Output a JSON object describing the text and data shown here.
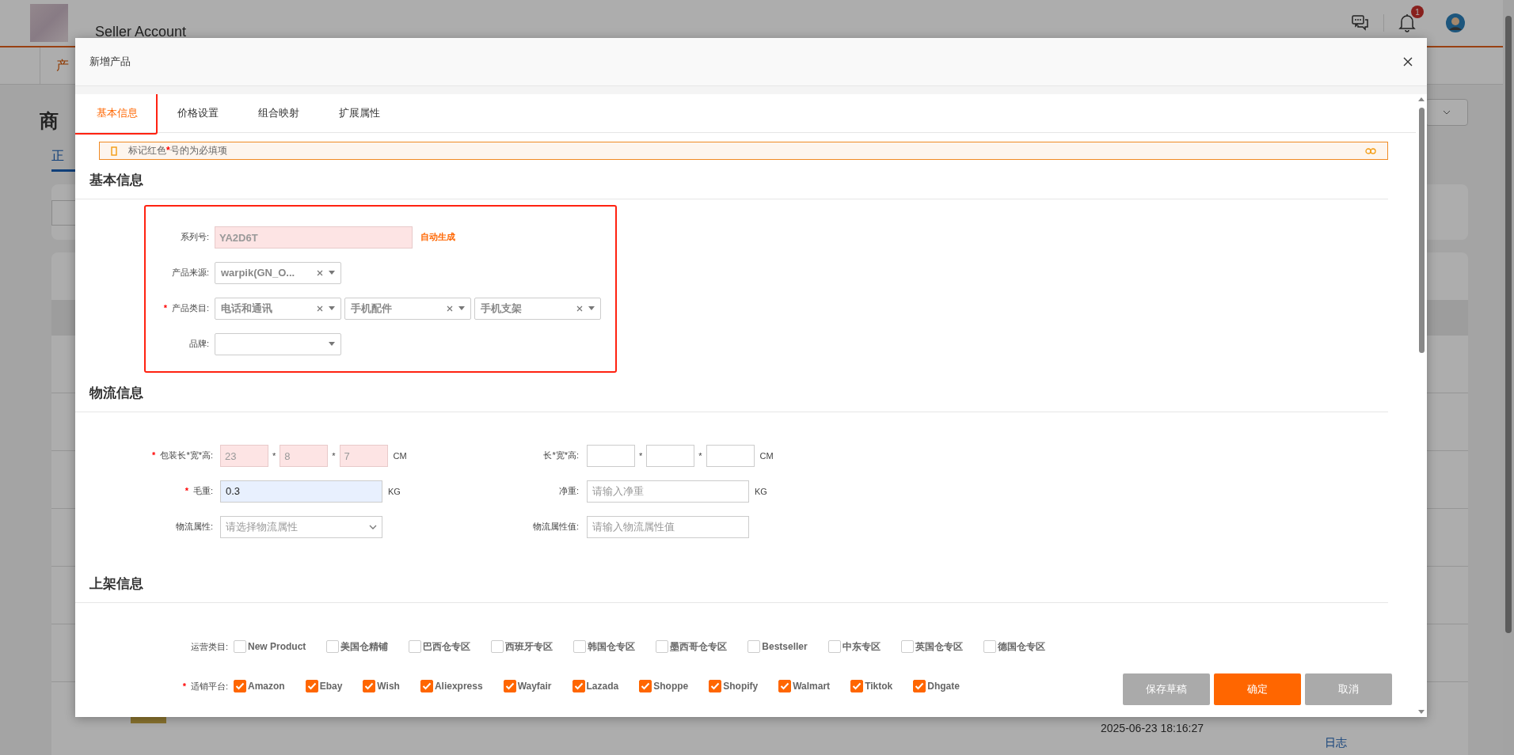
{
  "app_header": {
    "title": "Seller Account",
    "notification_count": "1"
  },
  "background": {
    "nav_tab": "产",
    "page_title": "商",
    "status_tab": "正",
    "row_time": "2025-06-23 18:16:27",
    "row_link": "日志"
  },
  "modal": {
    "title": "新增产品",
    "tabs": [
      {
        "label": "基本信息",
        "selected": true
      },
      {
        "label": "价格设置",
        "selected": false
      },
      {
        "label": "组合映射",
        "selected": false
      },
      {
        "label": "扩展属性",
        "selected": false
      }
    ],
    "notice": {
      "before": "标记红色",
      "mark": "*",
      "after": "号的为必填项"
    },
    "basic": {
      "title": "基本信息",
      "highlighted": true,
      "fields": [
        {
          "kind": "text",
          "label": "系列号:",
          "value": "YA2D6T",
          "readonly": true,
          "note": "自动生成"
        },
        {
          "kind": "select",
          "label": "产品来源:",
          "selects": [
            {
              "value": "warpik(GN_O...",
              "clearable": true
            }
          ]
        },
        {
          "kind": "select",
          "marker": "*",
          "label": "产品类目:",
          "selects": [
            {
              "value": "电话和通讯",
              "clearable": true
            },
            {
              "value": "手机配件",
              "clearable": true
            },
            {
              "value": "手机支架",
              "clearable": true
            }
          ]
        },
        {
          "kind": "select",
          "label": "品牌:",
          "selects": [
            {
              "clearable": false
            }
          ]
        }
      ]
    },
    "logistics": {
      "title": "物流信息",
      "rows": [
        [
          {
            "kind": "dims",
            "marker": "*",
            "label": "包装长*宽*高:",
            "readonly": true,
            "values": [
              "23",
              "8",
              "7"
            ],
            "separators": [
              "*",
              "*"
            ],
            "unit": "CM"
          },
          {
            "kind": "dims",
            "label": "长*宽*高:",
            "readonly": false,
            "separators": [
              "*",
              "*"
            ],
            "unit": "CM"
          }
        ],
        [
          {
            "kind": "text",
            "marker": "*",
            "label": "毛重:",
            "value": "0.3",
            "autofilled": true,
            "unit": "KG"
          },
          {
            "kind": "text",
            "label": "净重:",
            "placeholder": "请输入净重",
            "autofilled": false,
            "unit": "KG"
          }
        ],
        [
          {
            "kind": "select",
            "label": "物流属性:",
            "placeholder": "请选择物流属性"
          },
          {
            "kind": "text",
            "label": "物流属性值:",
            "placeholder": "请输入物流属性值",
            "autofilled": false
          }
        ]
      ]
    },
    "listing": {
      "title": "上架信息",
      "groups": [
        {
          "label": "运营类目:",
          "options": [
            {
              "label": "New Product",
              "checked": false
            },
            {
              "label": "美国仓精铺",
              "checked": false
            },
            {
              "label": "巴西仓专区",
              "checked": false
            },
            {
              "label": "西班牙专区",
              "checked": false
            },
            {
              "label": "韩国仓专区",
              "checked": false
            },
            {
              "label": "墨西哥仓专区",
              "checked": false
            },
            {
              "label": "Bestseller",
              "checked": false
            },
            {
              "label": "中东专区",
              "checked": false
            },
            {
              "label": "英国仓专区",
              "checked": false
            },
            {
              "label": "德国仓专区",
              "checked": false
            }
          ]
        },
        {
          "marker": "*",
          "label": "适销平台:",
          "options": [
            {
              "label": "Amazon",
              "checked": true
            },
            {
              "label": "Ebay",
              "checked": true
            },
            {
              "label": "Wish",
              "checked": true
            },
            {
              "label": "Aliexpress",
              "checked": true
            },
            {
              "label": "Wayfair",
              "checked": true
            },
            {
              "label": "Lazada",
              "checked": true
            },
            {
              "label": "Shoppe",
              "checked": true
            },
            {
              "label": "Shopify",
              "checked": true
            },
            {
              "label": "Walmart",
              "checked": true
            },
            {
              "label": "Tiktok",
              "checked": true
            },
            {
              "label": "Dhgate",
              "checked": true
            }
          ]
        }
      ]
    },
    "buttons": [
      {
        "kind": "secondary",
        "label": "保存草稿"
      },
      {
        "kind": "primary",
        "label": "确定"
      },
      {
        "kind": "secondary",
        "label": "取消"
      }
    ]
  }
}
